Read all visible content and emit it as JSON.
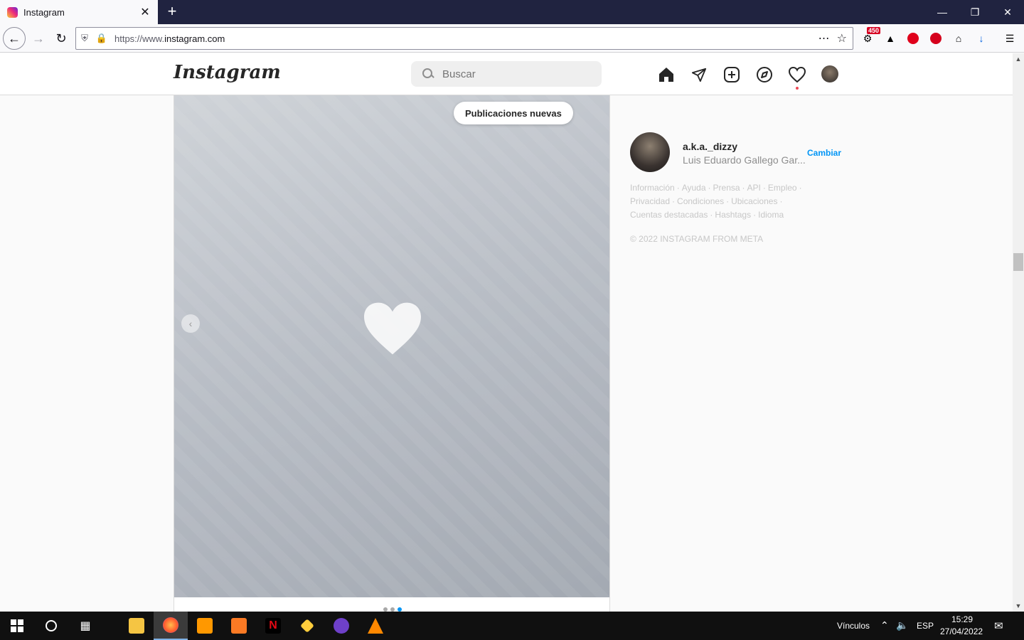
{
  "browser": {
    "tab_title": "Instagram",
    "tab_close": "✕",
    "new_tab": "+",
    "url_prefix": "https://www.",
    "url_host": "instagram.com",
    "ext_badge": "450"
  },
  "instagram": {
    "logo": "Instagram",
    "search_placeholder": "Buscar",
    "new_posts_label": "Publicaciones nuevas",
    "user": {
      "username": "a.k.a._dizzy",
      "full_name": "Luis Eduardo Gallego Gar...",
      "switch_label": "Cambiar"
    },
    "footer_links": [
      "Información",
      "Ayuda",
      "Prensa",
      "API",
      "Empleo",
      "Privacidad",
      "Condiciones",
      "Ubicaciones",
      "Cuentas destacadas",
      "Hashtags",
      "Idioma"
    ],
    "copyright": "© 2022 INSTAGRAM FROM META"
  },
  "taskbar": {
    "links_label": "Vínculos",
    "language": "ESP",
    "time": "15:29",
    "date": "27/04/2022"
  },
  "colors": {
    "accent_blue": "#0095f6",
    "notif_red": "#ed4956",
    "firefox_frame": "#202340"
  }
}
